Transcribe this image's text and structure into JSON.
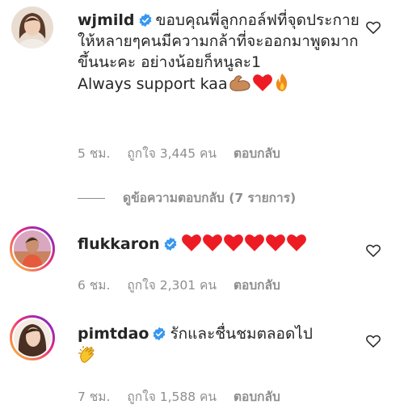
{
  "comments": [
    {
      "username": "wjmild",
      "text": "ขอบคุณพี่ลูกกอล์ฟที่จุดประกายให้หลายๆคนมีความกล้าที่จะออกมาพูดมากขึ้นนะคะ อย่างน้อยก็หนูละ1",
      "text2": "Always support kaa",
      "time": "5 ชม.",
      "likes": "ถูกใจ 3,445 คน",
      "reply": "ตอบกลับ",
      "view_replies": "ดูข้อความตอบกลับ (7 รายการ)"
    },
    {
      "username": "flukkaron",
      "time": "6 ชม.",
      "likes": "ถูกใจ 2,301 คน",
      "reply": "ตอบกลับ"
    },
    {
      "username": "pimtdao",
      "text": "รักและชื่นชมตลอดไป",
      "time": "7 ชม.",
      "likes": "ถูกใจ 1,588 คน",
      "reply": "ตอบกลับ"
    }
  ],
  "icons": {
    "verified": "verified-badge-icon",
    "like": "heart-outline-icon",
    "emoji_heart": "red-heart-emoji",
    "emoji_muscle": "flexed-biceps-emoji",
    "emoji_fire": "fire-emoji",
    "emoji_clap": "clapping-hands-emoji"
  },
  "colors": {
    "verified": "#3897f0",
    "meta": "#8e8e8e",
    "text": "#262626",
    "heart": "#ed1c24"
  }
}
